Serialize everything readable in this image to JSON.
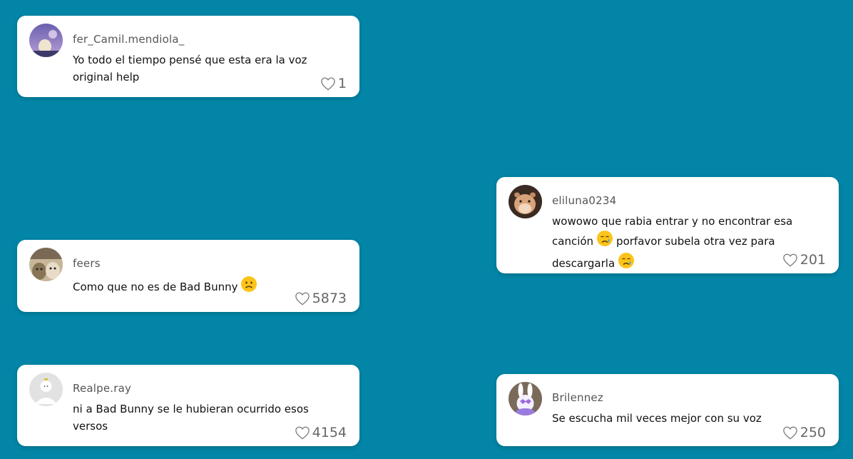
{
  "comments": [
    {
      "id": "c1",
      "username": "fer_Camil.mendiola_",
      "text": "Yo todo el tiempo pensé que esta era la voz original help",
      "likes": "1",
      "avatar_icon": "lavender-sky-photo-avatar-icon"
    },
    {
      "id": "c2",
      "username": "feers",
      "text": "Como que no es de Bad Bunny",
      "emoji": "worried-face-icon",
      "likes": "5873",
      "avatar_icon": "cats-photo-avatar-icon"
    },
    {
      "id": "c3",
      "username": "Realpe.ray",
      "text": "ni a Bad Bunny se le hubieran ocurrido esos versos",
      "likes": "4154",
      "avatar_icon": "default-avatar-icon"
    },
    {
      "id": "c4",
      "username": "eliluna0234",
      "text_part1": "wowowo que rabia entrar y no encontrar esa canción",
      "text_part2": "porfavor subela otra vez para descargarla",
      "emoji": "crying-face-icon",
      "likes": "201",
      "avatar_icon": "hamster-photo-avatar-icon"
    },
    {
      "id": "c5",
      "username": "Brilennez",
      "text": "Se escucha mil veces mejor con su voz",
      "likes": "250",
      "avatar_icon": "bunny-photo-avatar-icon"
    }
  ],
  "colors": {
    "background": "#0285a6",
    "card": "#ffffff",
    "heart": "#666666"
  }
}
